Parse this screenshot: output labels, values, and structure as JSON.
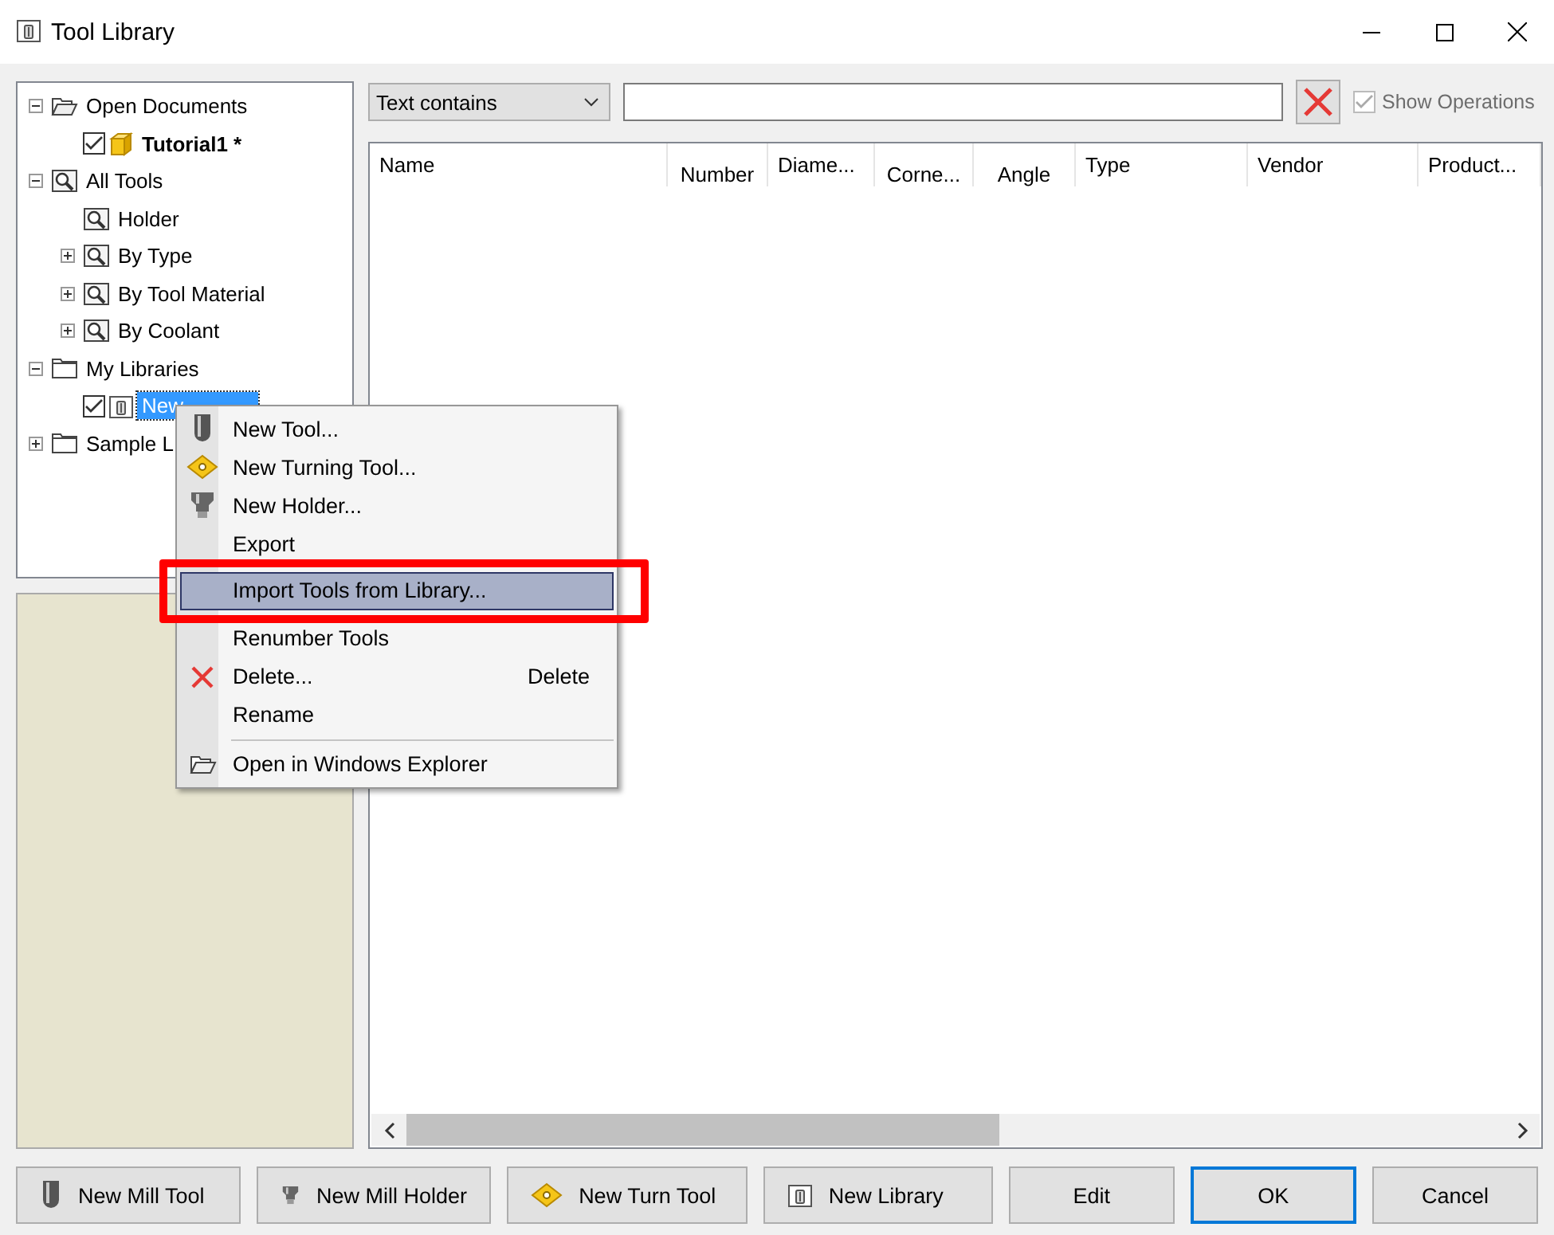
{
  "window": {
    "title": "Tool Library"
  },
  "tree": [
    {
      "kind": "documents",
      "label": "Open Documents",
      "expanded": true,
      "selected": false,
      "children": [
        {
          "kind": "document",
          "label": "Tutorial1 *",
          "checked": true,
          "bold": true,
          "selected": false
        }
      ]
    },
    {
      "kind": "filter",
      "label": "All Tools",
      "expanded": true,
      "selected": false,
      "children": [
        {
          "kind": "filter",
          "label": "Holder",
          "selected": false
        },
        {
          "kind": "filter",
          "label": "By Type",
          "expanded": false,
          "selected": false
        },
        {
          "kind": "filter",
          "label": "By Tool Material",
          "expanded": false,
          "selected": false
        },
        {
          "kind": "filter",
          "label": "By Coolant",
          "expanded": false,
          "selected": false
        }
      ]
    },
    {
      "kind": "folder",
      "label": "My Libraries",
      "expanded": true,
      "selected": false,
      "children": [
        {
          "kind": "library",
          "label": "New",
          "checked": true,
          "selected": true
        }
      ]
    },
    {
      "kind": "folder",
      "label": "Sample L",
      "expanded": false,
      "selected": false
    }
  ],
  "filter": {
    "mode": "Text contains"
  },
  "show_operations": {
    "label": "Show Operations",
    "checked": true,
    "disabled": true
  },
  "table": {
    "columns": [
      {
        "label": "Name"
      },
      {
        "label": "Number"
      },
      {
        "label": "Diame..."
      },
      {
        "label": "Corne..."
      },
      {
        "label": "Angle"
      },
      {
        "label": "Type"
      },
      {
        "label": "Vendor"
      },
      {
        "label": "Product..."
      }
    ]
  },
  "context_menu": [
    {
      "kind": "item",
      "label": "New Tool...",
      "selected": false
    },
    {
      "kind": "item",
      "label": "New Turning Tool...",
      "selected": false
    },
    {
      "kind": "item",
      "label": "New Holder...",
      "selected": false
    },
    {
      "kind": "item",
      "label": "Export",
      "selected": false
    },
    {
      "kind": "item",
      "label": "Import Tools from Library...",
      "selected": true
    },
    {
      "kind": "item",
      "label": "Renumber Tools",
      "selected": false
    },
    {
      "kind": "item",
      "label": "Delete...",
      "shortcut": "Delete",
      "selected": false
    },
    {
      "kind": "item",
      "label": "Rename",
      "selected": false
    },
    {
      "kind": "separator"
    },
    {
      "kind": "item",
      "label": "Open in Windows Explorer",
      "selected": false
    }
  ],
  "buttons": [
    {
      "label": "New Mill Tool",
      "default": false
    },
    {
      "label": "New Mill Holder",
      "default": false
    },
    {
      "label": "New Turn Tool",
      "default": false
    },
    {
      "label": "New Library",
      "default": false
    },
    {
      "label": "Edit",
      "default": false
    },
    {
      "label": "OK",
      "default": true
    },
    {
      "label": "Cancel",
      "default": false
    }
  ]
}
